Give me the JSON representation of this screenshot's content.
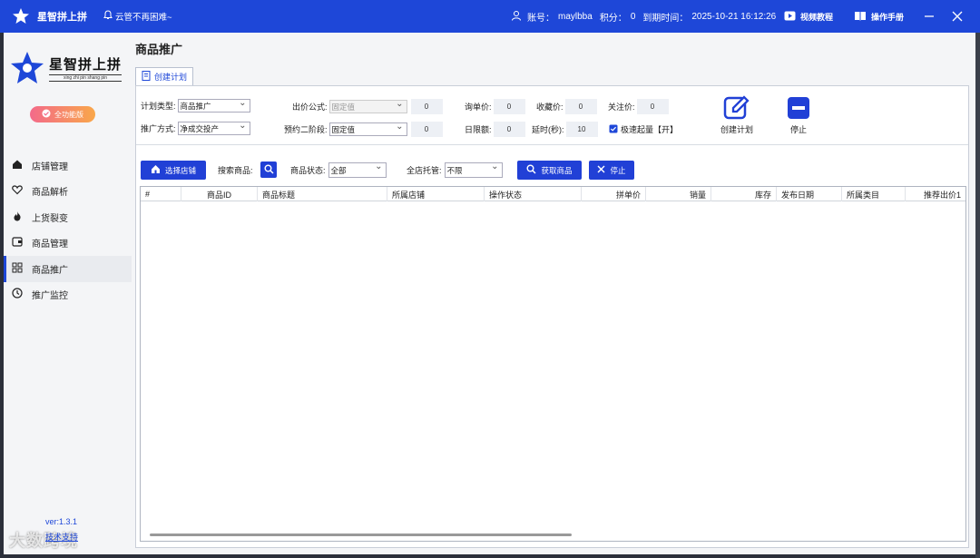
{
  "titlebar": {
    "app_name": "星智拼上拼",
    "notice": "云管不再困难~",
    "account_label": "账号：",
    "account_value": "maylbba",
    "points_label": "积分：",
    "points_value": "0",
    "expire_label": "到期时间：",
    "expire_value": "2025-10-21 16:12:26",
    "video_tutorial": "视频教程",
    "manual": "操作手册"
  },
  "sidebar": {
    "logo_cn": "星智拼上拼",
    "logo_py": "xing zhi pin shang pin",
    "badge": "全功能版",
    "items": [
      {
        "label": "店铺管理",
        "icon": "home-icon"
      },
      {
        "label": "商品解析",
        "icon": "heart-icon"
      },
      {
        "label": "上货裂变",
        "icon": "fire-icon"
      },
      {
        "label": "商品管理",
        "icon": "wallet-icon"
      },
      {
        "label": "商品推广",
        "icon": "grid-icon"
      },
      {
        "label": "推广监控",
        "icon": "clock-icon"
      }
    ],
    "version": "ver:1.3.1",
    "watermark": "大数跨境",
    "link": "技术支持"
  },
  "main": {
    "page_title": "商品推广",
    "tab": "创建计划",
    "form": {
      "plan_type_label": "计划类型:",
      "plan_type_value": "商品推广",
      "bid_formula_label": "出价公式:",
      "bid_formula_value": "固定值",
      "bid_formula_num": "0",
      "inquiry_price_label": "询单价:",
      "inquiry_price_value": "0",
      "fav_price_label": "收藏价:",
      "fav_price_value": "0",
      "follow_price_label": "关注价:",
      "follow_price_value": "0",
      "promo_method_label": "推广方式:",
      "promo_method_value": "净成交投产",
      "stage2_label": "预约二阶段:",
      "stage2_value": "固定值",
      "stage2_num": "0",
      "daily_limit_label": "日限额:",
      "daily_limit_value": "0",
      "delay_label": "延时(秒):",
      "delay_value": "10",
      "fast_start_label": "极速起量【开】",
      "create_plan_btn": "创建计划",
      "stop_btn": "停止"
    },
    "toolbar": {
      "select_shop_btn": "选择店铺",
      "search_label": "搜索商品:",
      "status_label": "商品状态:",
      "status_value": "全部",
      "managed_label": "全店托管:",
      "managed_value": "不限",
      "fetch_btn": "获取商品",
      "stop_btn": "停止"
    },
    "table": {
      "columns": [
        "#",
        "商品ID",
        "商品标题",
        "所属店铺",
        "操作状态",
        "拼单价",
        "销量",
        "库存",
        "发布日期",
        "所属类目",
        "推荐出价1"
      ]
    }
  },
  "colors": {
    "brand_blue": "#1e47d8",
    "badge_gradient_start": "#f36a8a",
    "badge_gradient_end": "#f9a74a"
  }
}
